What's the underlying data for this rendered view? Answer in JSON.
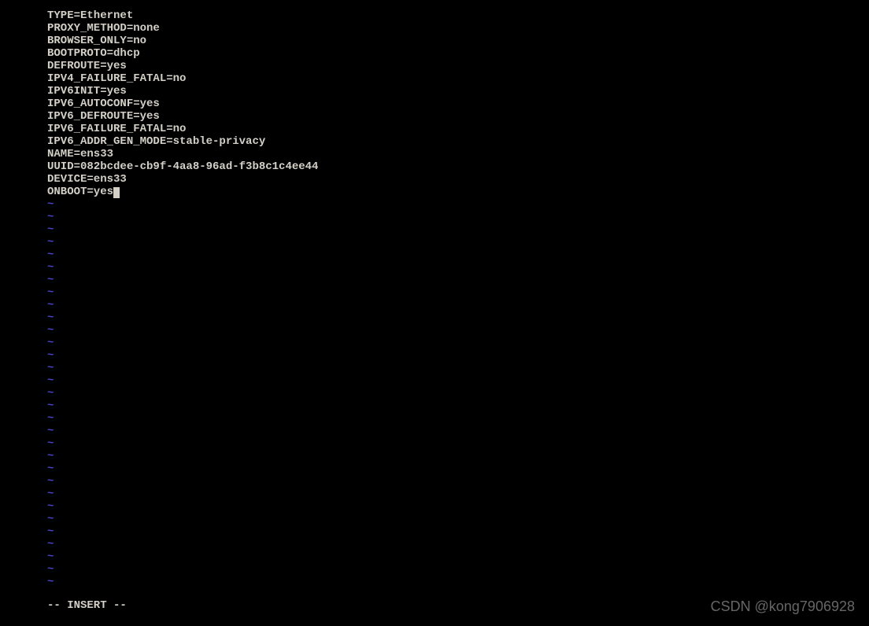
{
  "file_lines": [
    "TYPE=Ethernet",
    "PROXY_METHOD=none",
    "BROWSER_ONLY=no",
    "BOOTPROTO=dhcp",
    "DEFROUTE=yes",
    "IPV4_FAILURE_FATAL=no",
    "IPV6INIT=yes",
    "IPV6_AUTOCONF=yes",
    "IPV6_DEFROUTE=yes",
    "IPV6_FAILURE_FATAL=no",
    "IPV6_ADDR_GEN_MODE=stable-privacy",
    "NAME=ens33",
    "UUID=082bcdee-cb9f-4aa8-96ad-f3b8c1c4ee44",
    "DEVICE=ens33",
    "ONBOOT=yes"
  ],
  "tilde_char": "~",
  "tilde_count": 31,
  "status_text": "-- INSERT --",
  "watermark_text": "CSDN @kong7906928"
}
